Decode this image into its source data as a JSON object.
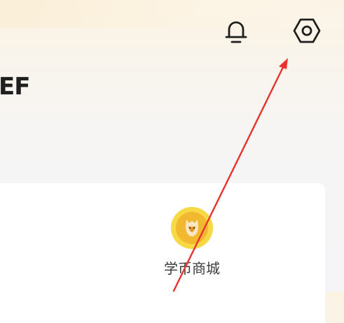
{
  "header": {
    "title_fragment": "EF",
    "bell_icon": "bell-icon",
    "settings_icon": "gear-icon"
  },
  "shortcuts": [
    {
      "label": "学币商城",
      "icon": "coin-icon"
    }
  ],
  "colors": {
    "annotation_arrow": "#e8322b",
    "coin_outer": "#f7d945",
    "coin_inner": "#f2b830"
  }
}
